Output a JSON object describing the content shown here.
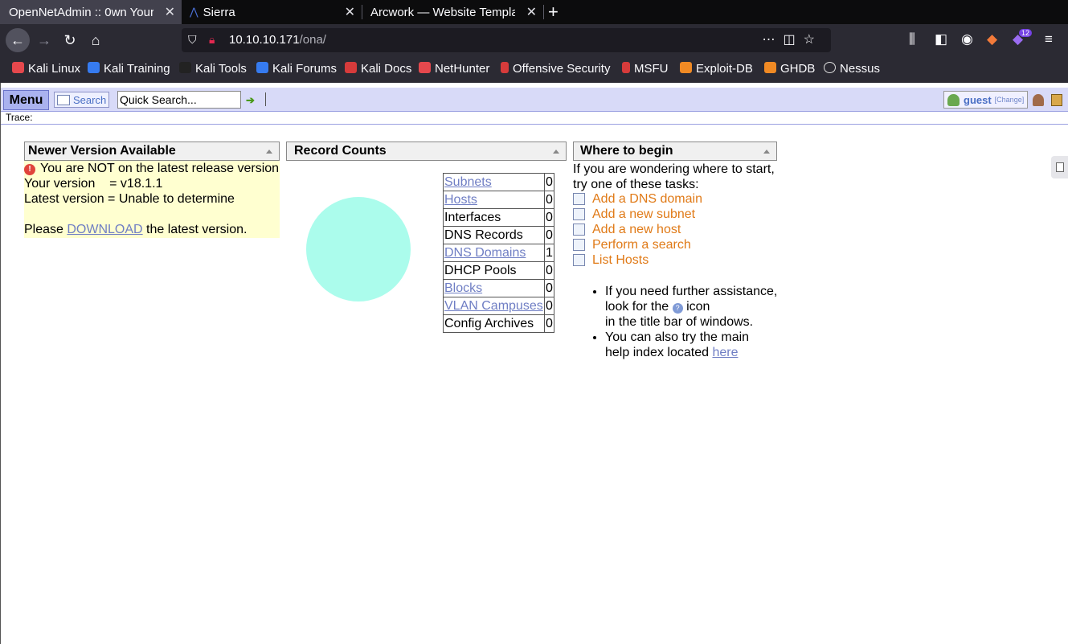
{
  "browser": {
    "tabs": [
      {
        "title": "OpenNetAdmin :: 0wn Your",
        "active": true
      },
      {
        "title": "Sierra",
        "active": false
      },
      {
        "title": "Arcwork — Website Templa",
        "active": false
      }
    ],
    "newtab_label": "+",
    "url": {
      "host": "10.10.10.171",
      "path": "/ona/"
    },
    "extension_badge": "12",
    "bookmarks": [
      {
        "label": "Kali Linux",
        "color": "#e5484d"
      },
      {
        "label": "Kali Training",
        "color": "#367bf0"
      },
      {
        "label": "Kali Tools",
        "color": "#222222"
      },
      {
        "label": "Kali Forums",
        "color": "#367bf0"
      },
      {
        "label": "Kali Docs",
        "color": "#d63b3b"
      },
      {
        "label": "NetHunter",
        "color": "#e5484d"
      },
      {
        "label": "Offensive Security",
        "color": "#d63b3b"
      },
      {
        "label": "MSFU",
        "color": "#d63b3b"
      },
      {
        "label": "Exploit-DB",
        "color": "#f08a24"
      },
      {
        "label": "GHDB",
        "color": "#f08a24"
      },
      {
        "label": "Nessus",
        "color": "#dddddd"
      }
    ]
  },
  "ona": {
    "menu_label": "Menu",
    "search_label": "Search",
    "quick_search_value": "Quick Search...",
    "user": {
      "name": "guest",
      "change_label": "[Change]"
    },
    "trace_label": "Trace:",
    "newer": {
      "title": "Newer Version Available",
      "warning": "You are NOT on the latest release version",
      "your_version": "Your version    = v18.1.1",
      "latest_version": "Latest version = Unable to determine",
      "download_prefix": "Please ",
      "download_link": "DOWNLOAD",
      "download_suffix": " the latest version."
    },
    "record_counts": {
      "title": "Record Counts",
      "pie_color": "#abfcec",
      "rows": [
        {
          "label": "Subnets",
          "count": "0",
          "link": true
        },
        {
          "label": "Hosts",
          "count": "0",
          "link": true
        },
        {
          "label": "Interfaces",
          "count": "0",
          "link": false
        },
        {
          "label": "DNS Records",
          "count": "0",
          "link": false
        },
        {
          "label": "DNS Domains",
          "count": "1",
          "link": true
        },
        {
          "label": "DHCP Pools",
          "count": "0",
          "link": false
        },
        {
          "label": "Blocks",
          "count": "0",
          "link": true
        },
        {
          "label": "VLAN Campuses",
          "count": "0",
          "link": true
        },
        {
          "label": "Config Archives",
          "count": "0",
          "link": false
        }
      ]
    },
    "where": {
      "title": "Where to begin",
      "intro_1": "If you are wondering where to start,",
      "intro_2": "try one of these tasks:",
      "tasks": [
        "Add a DNS domain",
        "Add a new subnet",
        "Add a new host",
        "Perform a search",
        "List Hosts"
      ],
      "help_1a": "If you need further assistance,",
      "help_1b": "look for the",
      "help_1c": "icon",
      "help_1d": "in the title bar of windows.",
      "help_2a": "You can also try the main",
      "help_2b": "help index located",
      "help_2_link": "here"
    }
  }
}
